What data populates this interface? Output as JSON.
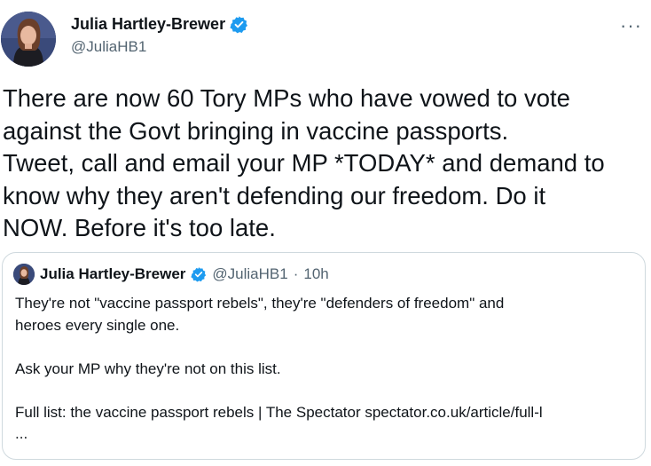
{
  "tweet": {
    "author": {
      "name": "Julia Hartley-Brewer",
      "handle": "@JuliaHB1",
      "verified_icon": "verified-badge-icon"
    },
    "more_label": "···",
    "text": "There are now 60 Tory MPs who have vowed to vote\nagainst the Govt bringing in vaccine passports.\nTweet, call and email your MP *TODAY* and demand to\nknow why they aren't defending our freedom. Do it\nNOW. Before it's too late."
  },
  "quoted_tweet": {
    "author": {
      "name": "Julia Hartley-Brewer",
      "handle": "@JuliaHB1",
      "separator": "·",
      "time": "10h"
    },
    "text": "They're not \"vaccine passport rebels\", they're \"defenders of freedom\" and\nheroes every single one.\n\nAsk your MP why they're not on this list.\n\nFull list: the vaccine passport rebels | The Spectator spectator.co.uk/article/full-l\n..."
  },
  "colors": {
    "text": "#0f1419",
    "secondary": "#536471",
    "verified": "#1d9bf0",
    "border": "#cfd9de"
  }
}
